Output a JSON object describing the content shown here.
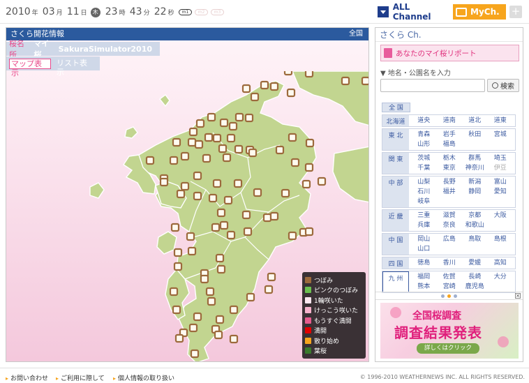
{
  "topbar": {
    "year": "2010",
    "year_unit": "年",
    "month": "03",
    "month_unit": "月",
    "day": "11",
    "day_unit": "日",
    "weekday": "木",
    "hour": "23",
    "hour_unit": "時",
    "minute": "43",
    "minute_unit": "分",
    "second": "22",
    "second_unit": "秒",
    "m1": "m1",
    "m2": "m2",
    "m3": "m3",
    "all_channel": "ALL Channel",
    "mych": "MyCh.",
    "plus": "+"
  },
  "main": {
    "title": "さくら開花情報",
    "region_link": "全国",
    "subnav": {
      "sakura_name": "桜名所",
      "my_sakura": "マイ桜",
      "simulator": "SakuraSimulator2010"
    },
    "view_tabs": {
      "map": "マップ表示",
      "list": "リスト表示"
    }
  },
  "legend": [
    {
      "label": "つぼみ",
      "color": "#9c6a3c"
    },
    {
      "label": "ピンクのつぼみ",
      "color": "#6cc050"
    },
    {
      "label": "1輪咲いた",
      "color": "#fde8f0"
    },
    {
      "label": "けっこう咲いた",
      "color": "#f6b2cc"
    },
    {
      "label": "もうすぐ満開",
      "color": "#e65c8e"
    },
    {
      "label": "満開",
      "color": "#e00000"
    },
    {
      "label": "散り始め",
      "color": "#f7a51d"
    },
    {
      "label": "葉桜",
      "color": "#3a7a2c"
    }
  ],
  "side": {
    "title": "さくら Ch.",
    "report": "あなたのマイ桜リポート",
    "place_label": "▼ 地名・公園名を入力",
    "search_value": "",
    "search_button": "検索",
    "zenkoku": "全 国",
    "regions": [
      {
        "name": "北海道",
        "prefs": [
          "道央",
          "道南",
          "道北",
          "道東"
        ]
      },
      {
        "name": "東 北",
        "prefs": [
          "青森",
          "岩手",
          "秋田",
          "宮城",
          "山形",
          "福島"
        ]
      },
      {
        "name": "関 東",
        "prefs": [
          "茨城",
          "栃木",
          "群馬",
          "埼玉",
          "千葉",
          "東京",
          "神奈川",
          "伊豆"
        ]
      },
      {
        "name": "中 部",
        "prefs": [
          "山梨",
          "長野",
          "新潟",
          "富山",
          "石川",
          "福井",
          "静岡",
          "愛知",
          "岐阜"
        ]
      },
      {
        "name": "近 畿",
        "prefs": [
          "三重",
          "滋賀",
          "京都",
          "大阪",
          "兵庫",
          "奈良",
          "和歌山"
        ]
      },
      {
        "name": "中 国",
        "prefs": [
          "岡山",
          "広島",
          "鳥取",
          "島根",
          "山口"
        ]
      },
      {
        "name": "四 国",
        "prefs": [
          "徳島",
          "香川",
          "愛媛",
          "高知"
        ]
      },
      {
        "name": "九 州",
        "prefs": [
          "福岡",
          "佐賀",
          "長崎",
          "大分",
          "熊本",
          "宮崎",
          "鹿児島"
        ]
      }
    ],
    "banner": {
      "line1": "全国桜調査",
      "line2": "調査結果発表",
      "button": "詳しくはクリック"
    }
  },
  "footer": {
    "links": [
      "お問い合わせ",
      "ご利用に際して",
      "個人情報の取り扱い"
    ],
    "copyright": "© 1996-2010 WEATHERNEWS INC. ALL RIGHTS RESERVED."
  }
}
